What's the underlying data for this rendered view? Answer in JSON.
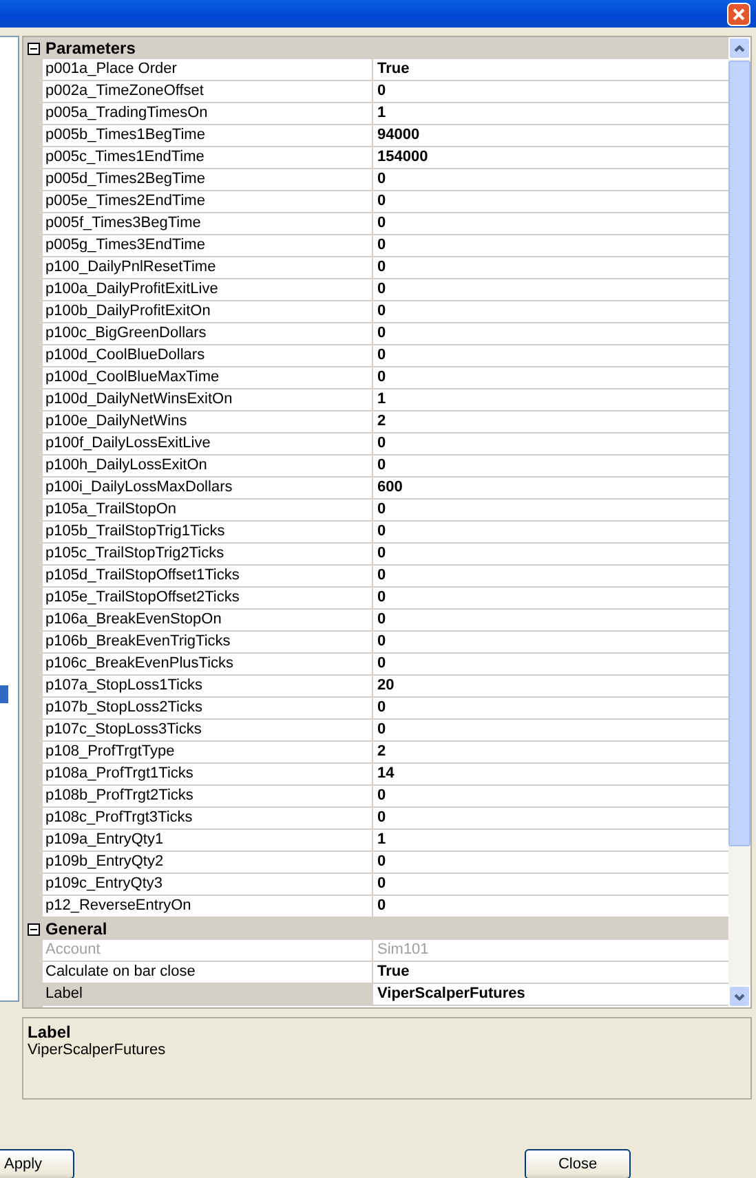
{
  "categories": [
    {
      "name": "Parameters",
      "expanded": true,
      "rows": [
        {
          "name": "p001a_Place Order",
          "value": "True",
          "disabled": false,
          "selected": false
        },
        {
          "name": "p002a_TimeZoneOffset",
          "value": "0",
          "disabled": false,
          "selected": false
        },
        {
          "name": "p005a_TradingTimesOn",
          "value": "1",
          "disabled": false,
          "selected": false
        },
        {
          "name": "p005b_Times1BegTime",
          "value": "94000",
          "disabled": false,
          "selected": false
        },
        {
          "name": "p005c_Times1EndTime",
          "value": "154000",
          "disabled": false,
          "selected": false
        },
        {
          "name": "p005d_Times2BegTime",
          "value": "0",
          "disabled": false,
          "selected": false
        },
        {
          "name": "p005e_Times2EndTime",
          "value": "0",
          "disabled": false,
          "selected": false
        },
        {
          "name": "p005f_Times3BegTime",
          "value": "0",
          "disabled": false,
          "selected": false
        },
        {
          "name": "p005g_Times3EndTime",
          "value": "0",
          "disabled": false,
          "selected": false
        },
        {
          "name": "p100_DailyPnlResetTime",
          "value": "0",
          "disabled": false,
          "selected": false
        },
        {
          "name": "p100a_DailyProfitExitLive",
          "value": "0",
          "disabled": false,
          "selected": false
        },
        {
          "name": "p100b_DailyProfitExitOn",
          "value": "0",
          "disabled": false,
          "selected": false
        },
        {
          "name": "p100c_BigGreenDollars",
          "value": "0",
          "disabled": false,
          "selected": false
        },
        {
          "name": "p100d_CoolBlueDollars",
          "value": "0",
          "disabled": false,
          "selected": false
        },
        {
          "name": "p100d_CoolBlueMaxTime",
          "value": "0",
          "disabled": false,
          "selected": false
        },
        {
          "name": "p100d_DailyNetWinsExitOn",
          "value": "1",
          "disabled": false,
          "selected": false
        },
        {
          "name": "p100e_DailyNetWins",
          "value": "2",
          "disabled": false,
          "selected": false
        },
        {
          "name": "p100f_DailyLossExitLive",
          "value": "0",
          "disabled": false,
          "selected": false
        },
        {
          "name": "p100h_DailyLossExitOn",
          "value": "0",
          "disabled": false,
          "selected": false
        },
        {
          "name": "p100i_DailyLossMaxDollars",
          "value": "600",
          "disabled": false,
          "selected": false
        },
        {
          "name": "p105a_TrailStopOn",
          "value": "0",
          "disabled": false,
          "selected": false
        },
        {
          "name": "p105b_TrailStopTrig1Ticks",
          "value": "0",
          "disabled": false,
          "selected": false
        },
        {
          "name": "p105c_TrailStopTrig2Ticks",
          "value": "0",
          "disabled": false,
          "selected": false
        },
        {
          "name": "p105d_TrailStopOffset1Ticks",
          "value": "0",
          "disabled": false,
          "selected": false
        },
        {
          "name": "p105e_TrailStopOffset2Ticks",
          "value": "0",
          "disabled": false,
          "selected": false
        },
        {
          "name": "p106a_BreakEvenStopOn",
          "value": "0",
          "disabled": false,
          "selected": false
        },
        {
          "name": "p106b_BreakEvenTrigTicks",
          "value": "0",
          "disabled": false,
          "selected": false
        },
        {
          "name": "p106c_BreakEvenPlusTicks",
          "value": "0",
          "disabled": false,
          "selected": false
        },
        {
          "name": "p107a_StopLoss1Ticks",
          "value": "20",
          "disabled": false,
          "selected": false
        },
        {
          "name": "p107b_StopLoss2Ticks",
          "value": "0",
          "disabled": false,
          "selected": false
        },
        {
          "name": "p107c_StopLoss3Ticks",
          "value": "0",
          "disabled": false,
          "selected": false
        },
        {
          "name": "p108_ProfTrgtType",
          "value": "2",
          "disabled": false,
          "selected": false
        },
        {
          "name": "p108a_ProfTrgt1Ticks",
          "value": "14",
          "disabled": false,
          "selected": false
        },
        {
          "name": "p108b_ProfTrgt2Ticks",
          "value": "0",
          "disabled": false,
          "selected": false
        },
        {
          "name": "p108c_ProfTrgt3Ticks",
          "value": "0",
          "disabled": false,
          "selected": false
        },
        {
          "name": "p109a_EntryQty1",
          "value": "1",
          "disabled": false,
          "selected": false
        },
        {
          "name": "p109b_EntryQty2",
          "value": "0",
          "disabled": false,
          "selected": false
        },
        {
          "name": "p109c_EntryQty3",
          "value": "0",
          "disabled": false,
          "selected": false
        },
        {
          "name": "p12_ReverseEntryOn",
          "value": "0",
          "disabled": false,
          "selected": false
        }
      ]
    },
    {
      "name": "General",
      "expanded": true,
      "rows": [
        {
          "name": "Account",
          "value": "Sim101",
          "disabled": true,
          "selected": false
        },
        {
          "name": "Calculate on bar close",
          "value": "True",
          "disabled": false,
          "selected": false
        },
        {
          "name": "Label",
          "value": "ViperScalperFutures",
          "disabled": false,
          "selected": true
        }
      ]
    }
  ],
  "description": {
    "title": "Label",
    "text": "ViperScalperFutures"
  },
  "buttons": [
    {
      "label": "Apply",
      "kind": "apply"
    },
    {
      "label": "Close",
      "kind": "close"
    }
  ]
}
